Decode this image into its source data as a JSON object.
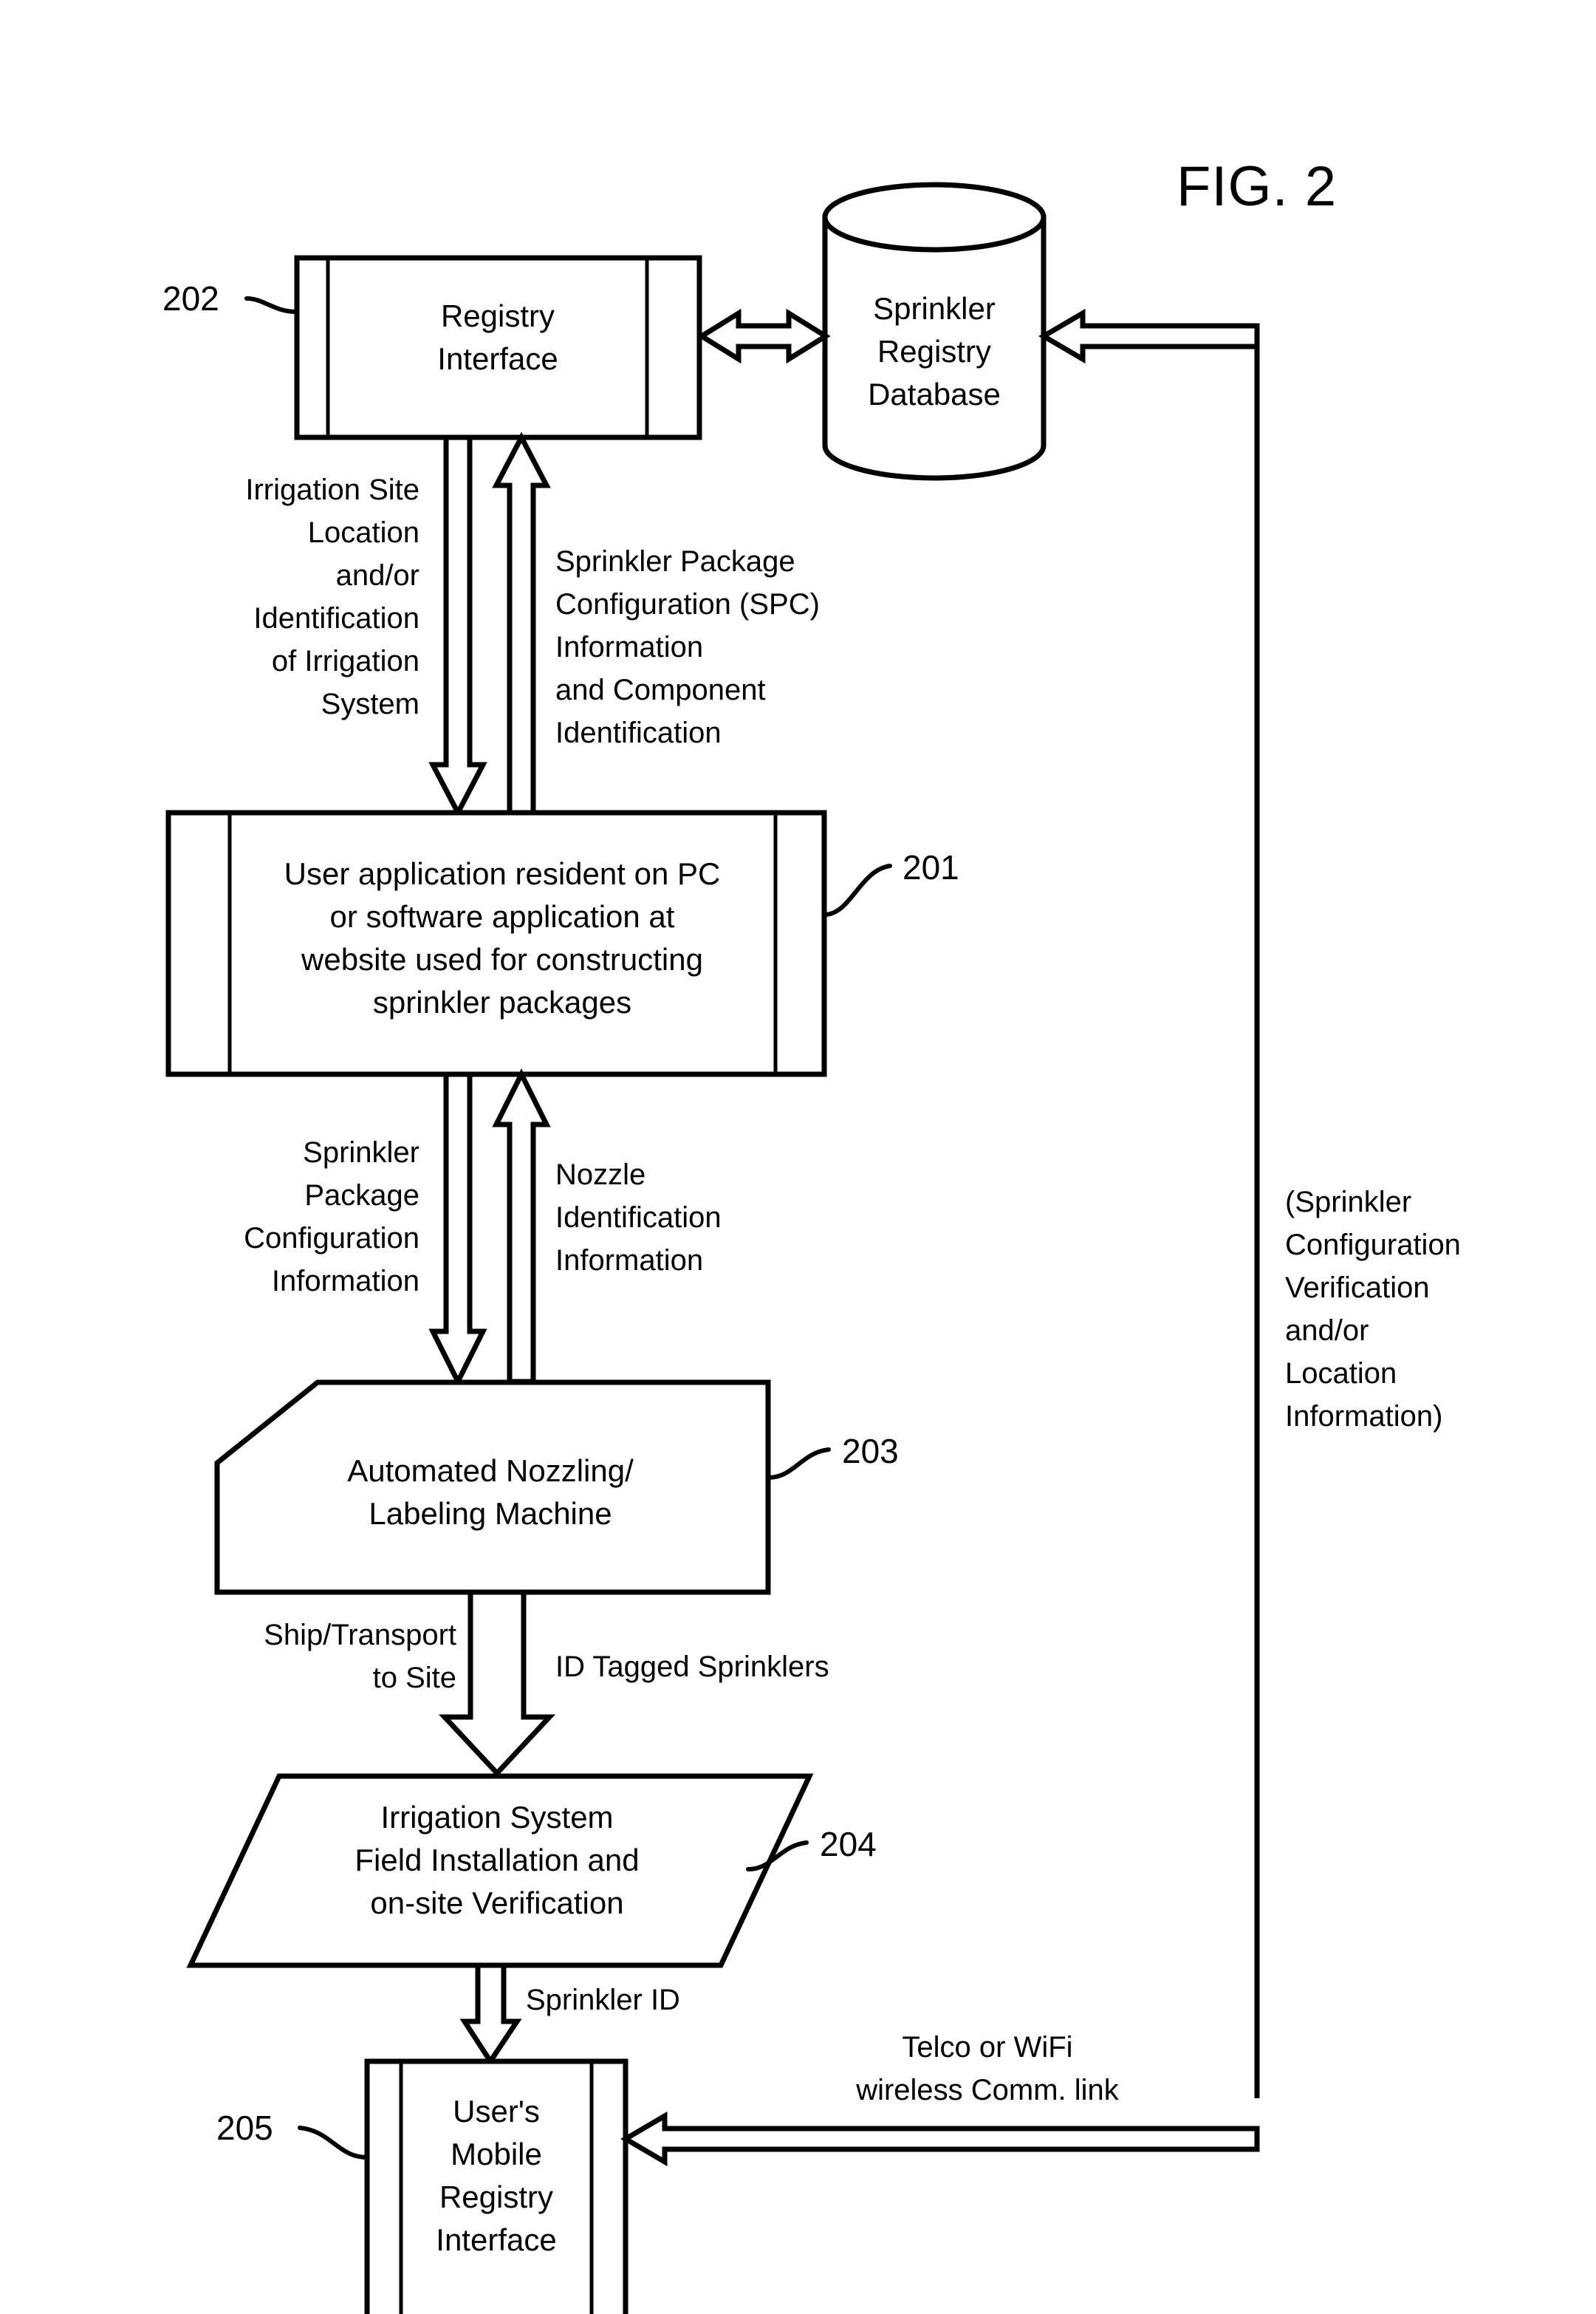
{
  "figure": {
    "title": "FIG. 2"
  },
  "nodes": {
    "registry_interface": {
      "ref": "202",
      "lines": [
        "Registry",
        "Interface"
      ]
    },
    "sprinkler_registry_database": {
      "lines": [
        "Sprinkler",
        "Registry",
        "Database"
      ]
    },
    "user_application": {
      "ref": "201",
      "lines": [
        "User application resident on PC",
        "or software application at",
        "website used for constructing",
        "sprinkler packages"
      ]
    },
    "nozzling_machine": {
      "ref": "203",
      "lines": [
        "Automated Nozzling/",
        "Labeling Machine"
      ]
    },
    "field_installation": {
      "ref": "204",
      "lines": [
        "Irrigation System",
        "Field Installation and",
        "on-site Verification"
      ]
    },
    "mobile_registry_interface": {
      "ref": "205",
      "lines": [
        "User's",
        "Mobile",
        "Registry",
        "Interface"
      ]
    }
  },
  "edge_labels": {
    "irrigation_site": {
      "lines": [
        "Irrigation Site",
        "Location",
        "and/or",
        "Identification",
        "of Irrigation",
        "System"
      ]
    },
    "spc_information": {
      "lines": [
        "Sprinkler Package",
        "Configuration (SPC)",
        "Information",
        "and Component",
        "Identification"
      ]
    },
    "sprinkler_package_config": {
      "lines": [
        "Sprinkler",
        "Package",
        "Configuration",
        "Information"
      ]
    },
    "nozzle_identification": {
      "lines": [
        "Nozzle",
        "Identification",
        "Information"
      ]
    },
    "ship_transport": {
      "lines": [
        "Ship/Transport",
        "to Site"
      ]
    },
    "id_tagged_sprinklers": {
      "lines": [
        "ID Tagged Sprinklers"
      ]
    },
    "sprinkler_id": {
      "lines": [
        "Sprinkler ID"
      ]
    },
    "telco_wifi_link": {
      "lines": [
        "Telco or WiFi",
        "wireless Comm. link"
      ]
    },
    "verification_return": {
      "lines": [
        "(Sprinkler",
        "Configuration",
        "Verification",
        "and/or",
        "Location",
        "Information)"
      ]
    }
  }
}
